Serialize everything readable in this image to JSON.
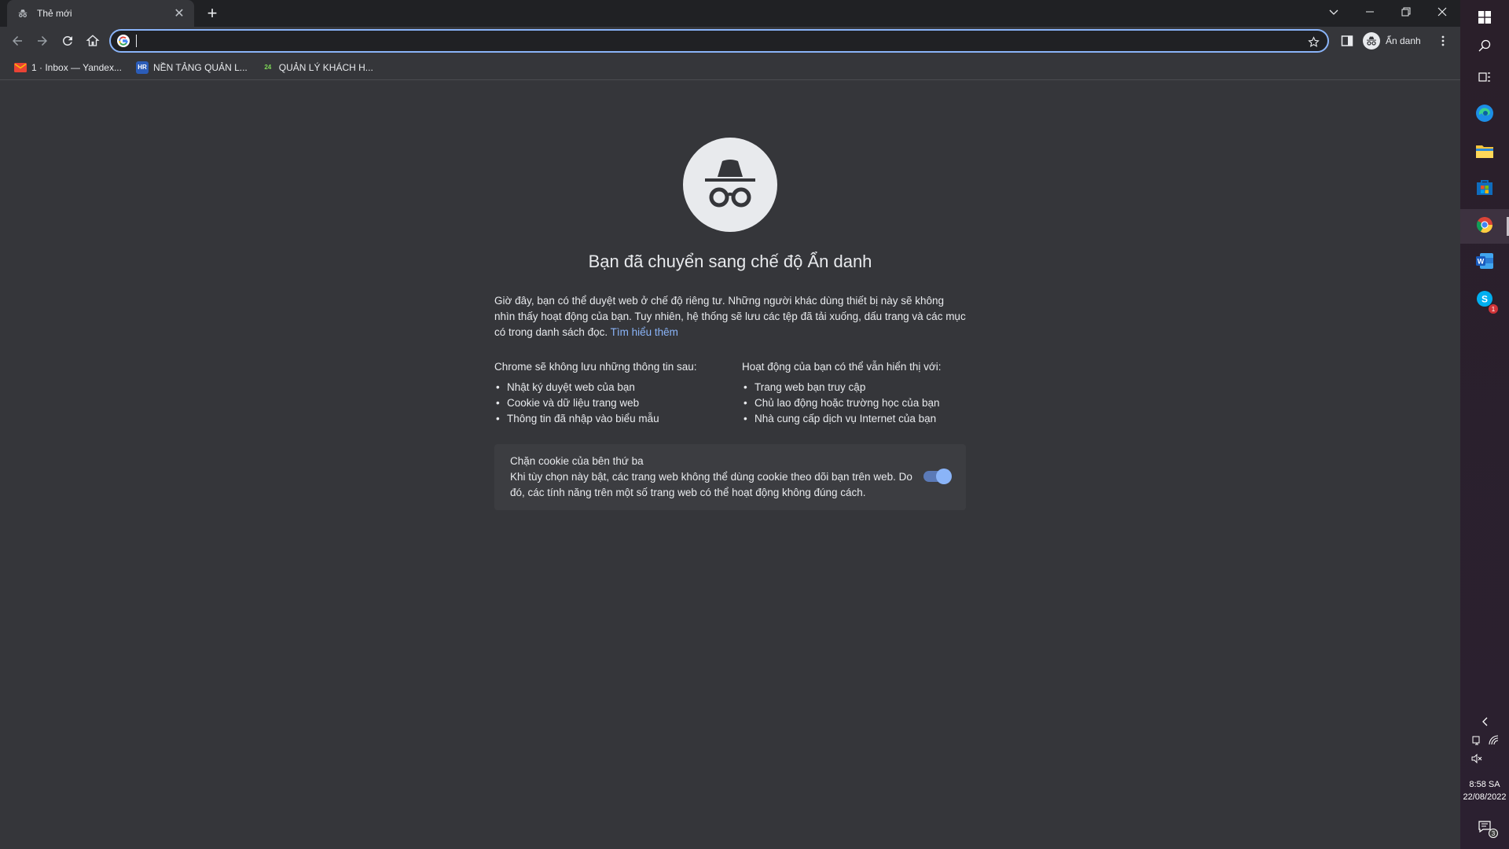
{
  "tab": {
    "title": "Thẻ mới",
    "close": "✕"
  },
  "new_tab": "+",
  "window_controls": {
    "dropdown": "⌄",
    "minimize": "—",
    "restore": "❐",
    "close": "✕"
  },
  "omnibox": {
    "value": "",
    "placeholder": ""
  },
  "profile": {
    "label": "Ẩn danh"
  },
  "bookmarks": [
    {
      "label": "1 · Inbox — Yandex...",
      "icon": "gmail-icon",
      "icon_text": ""
    },
    {
      "label": "NỀN TẢNG QUẢN L...",
      "icon": "hr-icon",
      "icon_text": "HR"
    },
    {
      "label": "QUẢN LÝ KHÁCH H...",
      "icon": "24-icon",
      "icon_text": "24"
    }
  ],
  "ntp": {
    "heading": "Bạn đã chuyển sang chế độ Ẩn danh",
    "intro": "Giờ đây, bạn có thể duyệt web ở chế độ riêng tư. Những người khác dùng thiết bị này sẽ không nhìn thấy hoạt động của bạn. Tuy nhiên, hệ thống sẽ lưu các tệp đã tải xuống, dấu trang và các mục có trong danh sách đọc.",
    "learn_more": "Tìm hiểu thêm",
    "left_col": {
      "title": "Chrome sẽ không lưu những thông tin sau:",
      "items": [
        "Nhật ký duyệt web của bạn",
        "Cookie và dữ liệu trang web",
        "Thông tin đã nhập vào biểu mẫu"
      ]
    },
    "right_col": {
      "title": "Hoạt động của bạn có thể vẫn hiển thị với:",
      "items": [
        "Trang web bạn truy cập",
        "Chủ lao động hoặc trường học của bạn",
        "Nhà cung cấp dịch vụ Internet của bạn"
      ]
    },
    "cookie_card": {
      "title": "Chặn cookie của bên thứ ba",
      "desc": "Khi tùy chọn này bật, các trang web không thể dùng cookie theo dõi bạn trên web. Do đó, các tính năng trên một số trang web có thể hoạt động không đúng cách.",
      "toggle_on": true
    }
  },
  "taskbar": {
    "skype_badge": "1",
    "notification_badge": "3",
    "time": "8:58 SA",
    "date": "22/08/2022"
  },
  "colors": {
    "accent": "#8ab4f8",
    "bg": "#35363a",
    "titlebar": "#202124"
  }
}
